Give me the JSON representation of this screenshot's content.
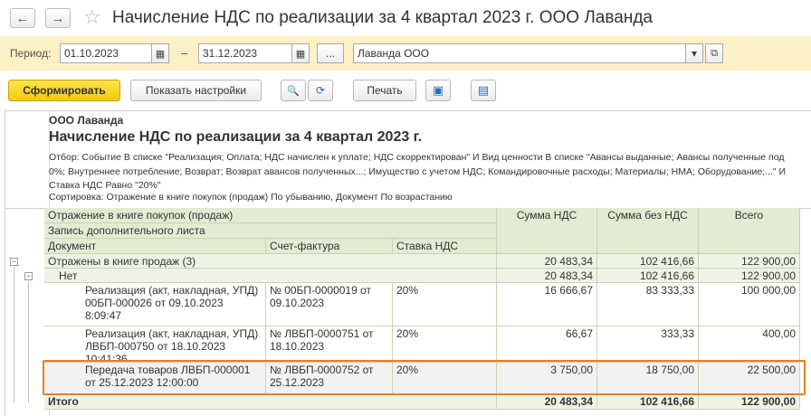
{
  "window": {
    "title": "Начисление НДС по реализации за 4 квартал 2023 г. ООО Лаванда",
    "back_glyph": "←",
    "forward_glyph": "→",
    "favorite_glyph": "☆",
    "icons": [
      "arrow-left-icon",
      "arrow-right-icon",
      "star-icon"
    ]
  },
  "period": {
    "label": "Период:",
    "from": "01.10.2023",
    "dash": "–",
    "to": "31.12.2023",
    "more_label": "...",
    "organization": "Лаванда ООО",
    "calendar_glyph": "▦",
    "dropdown_glyph": "▾",
    "open_glyph": "⧉"
  },
  "toolbar": {
    "generate_label": "Сформировать",
    "settings_label": "Показать настройки",
    "search_glyph": "🔍",
    "search_next_glyph": "⟳",
    "print_label": "Печать",
    "preview_glyph": "▣",
    "save_glyph": "▤"
  },
  "report": {
    "organization": "ООО Лаванда",
    "title": "Начисление НДС по реализации за 4 квартал 2023 г.",
    "filter": "Отбор: Событие В списке \"Реализация; Оплата; НДС начислен к уплате; НДС скорректирован\" И Вид ценности В списке \"Авансы выданные; Авансы полученные под 0%; Внутреннее потребление; Возврат; Возврат авансов полученных...; Имущество с учетом НДС; Командировочные расходы; Материалы; НМА; Оборудование;...\" И Ставка НДС Равно \"20%\"",
    "sorting": "Сортировка: Отражение в книге покупок (продаж) По убыванию, Документ По возрастанию"
  },
  "table": {
    "headers": {
      "reflection": "Отражение в книге покупок (продаж)",
      "additional_sheet": "Запись дополнительного листа",
      "document": "Документ",
      "invoice": "Счет-фактура",
      "rate": "Ставка НДС",
      "vat_sum": "Сумма НДС",
      "sum_without_vat": "Сумма без НДС",
      "total": "Всего"
    },
    "group": {
      "label": "Отражены в книге продаж (3)",
      "vat": "20 483,34",
      "net": "102 416,66",
      "total": "122 900,00"
    },
    "subgroup": {
      "label": "Нет",
      "vat": "20 483,34",
      "net": "102 416,66",
      "total": "122 900,00"
    },
    "rows": [
      {
        "document": "Реализация (акт, накладная, УПД) 00БП-000026 от 09.10.2023 8:09:47",
        "invoice": "№ 00БП-0000019 от 09.10.2023",
        "rate": "20%",
        "vat": "16 666,67",
        "net": "83 333,33",
        "total": "100 000,00"
      },
      {
        "document": "Реализация (акт, накладная, УПД) ЛВБП-000750 от 18.10.2023 10:41:36",
        "invoice": "№ ЛВБП-0000751 от 18.10.2023",
        "rate": "20%",
        "vat": "66,67",
        "net": "333,33",
        "total": "400,00"
      },
      {
        "document": "Передача товаров ЛВБП-000001 от 25.12.2023 12:00:00",
        "invoice": "№ ЛВБП-0000752 от 25.12.2023",
        "rate": "20%",
        "vat": "3 750,00",
        "net": "18 750,00",
        "total": "22 500,00"
      }
    ],
    "totals": {
      "label": "Итого",
      "vat": "20 483,34",
      "net": "102 416,66",
      "total": "122 900,00"
    },
    "collapse_glyph": "−"
  },
  "colors": {
    "period_panel": "#fbf0c6",
    "primary_button": "#f5d01f",
    "table_header": "#e2ecd2",
    "highlight_frame": "#f07d1a"
  }
}
